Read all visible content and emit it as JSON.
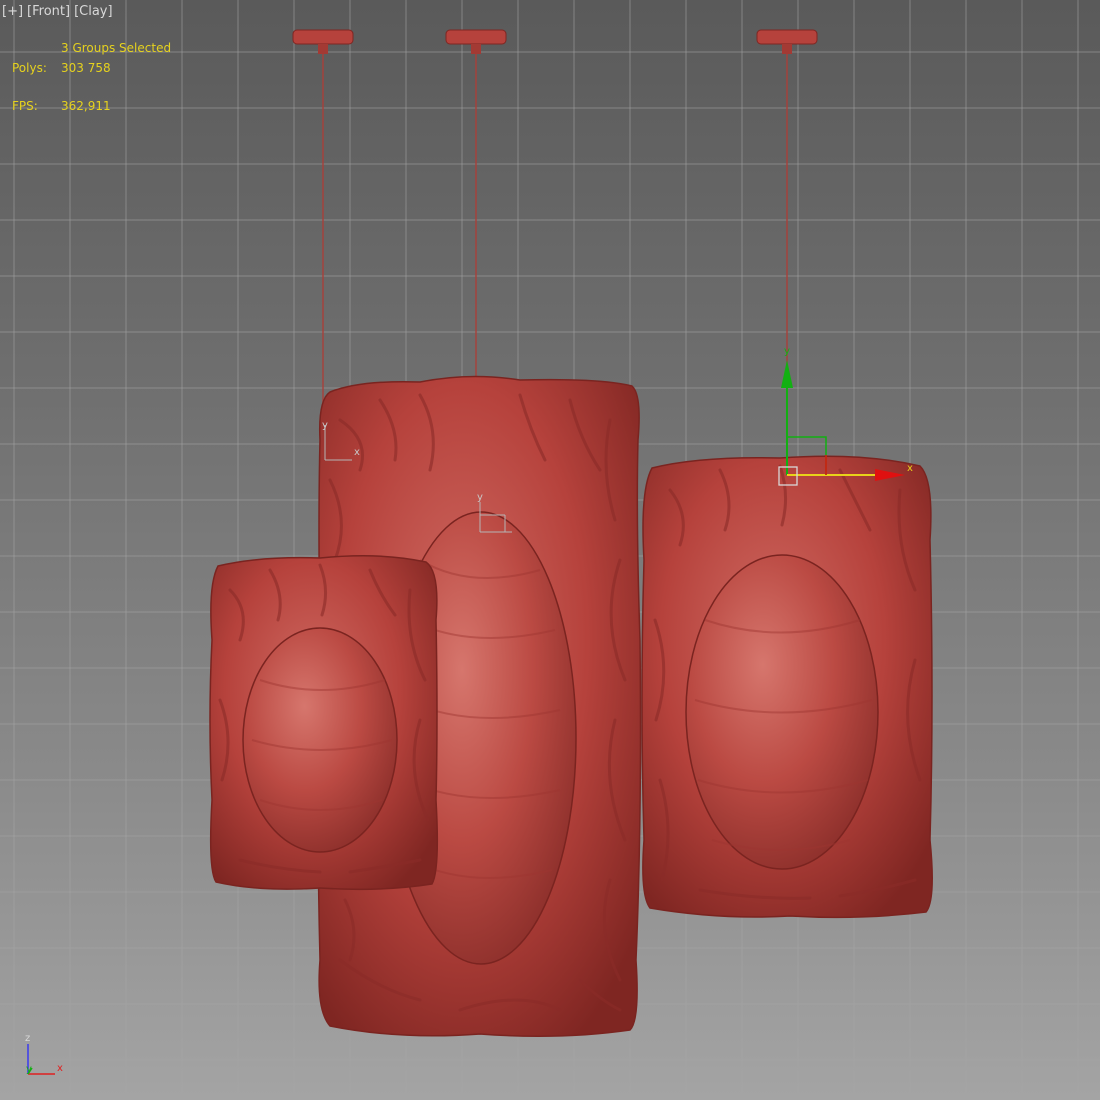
{
  "viewport": {
    "labels": [
      "[+]",
      "[Front]",
      "[Clay]"
    ],
    "selection_text": "3 Groups Selected",
    "polys_label": "Polys:",
    "polys_value": "303 758",
    "fps_label": "FPS:",
    "fps_value": "362,911"
  },
  "gizmo": {
    "y_label": "y",
    "x_label": "x"
  },
  "pivot_labels": {
    "y": "y",
    "x": "x"
  },
  "axis_tripod": {
    "z_label": "z",
    "y_label": "y",
    "x_label": "x"
  },
  "colors": {
    "clay": "#b6423c",
    "clay_dark": "#8a2a26",
    "clay_light": "#cf6a62",
    "stats_text": "#e6d21e",
    "label_text": "#d8d8d8",
    "grid": "#a0a0a0",
    "gizmo_x": "#e01010",
    "gizmo_y": "#12b012",
    "gizmo_yellow": "#e8d21a"
  }
}
